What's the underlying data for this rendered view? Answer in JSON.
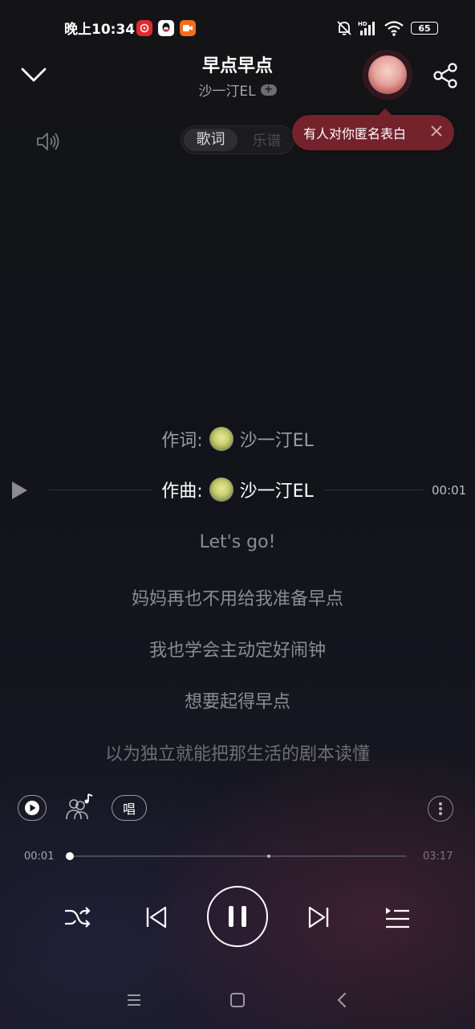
{
  "status_bar": {
    "time": "晚上10:34",
    "battery": "65",
    "icons": [
      "netease-music-icon",
      "qq-icon",
      "video-icon",
      "mute-bell-icon",
      "hd-signal-icon",
      "wifi-icon",
      "battery-icon"
    ]
  },
  "header": {
    "title": "早点早点",
    "artist": "沙一汀EL",
    "follow_label": "+"
  },
  "tabs": [
    {
      "label": "歌词",
      "active": true
    },
    {
      "label": "乐谱",
      "active": false
    }
  ],
  "popup": {
    "text": "有人对你匿名表白"
  },
  "lyrics": {
    "lyricist_prefix": "作词:",
    "lyricist_name": "沙一汀EL",
    "composer_prefix": "作曲:",
    "composer_name": "沙一汀EL",
    "lines": [
      "Let's go!",
      "妈妈再也不用给我准备早点",
      "我也学会主动定好闹钟",
      "想要起得早点",
      "以为独立就能把那生活的剧本读懂"
    ],
    "line_time": "00:01"
  },
  "actions": {
    "sing_label": "唱"
  },
  "progress": {
    "current": "00:01",
    "total": "03:17",
    "fraction": 0.005
  },
  "colors": {
    "popup_bg": "#74222c",
    "active_lyric": "#ffffff",
    "inactive_lyric": "#8c8c92"
  }
}
